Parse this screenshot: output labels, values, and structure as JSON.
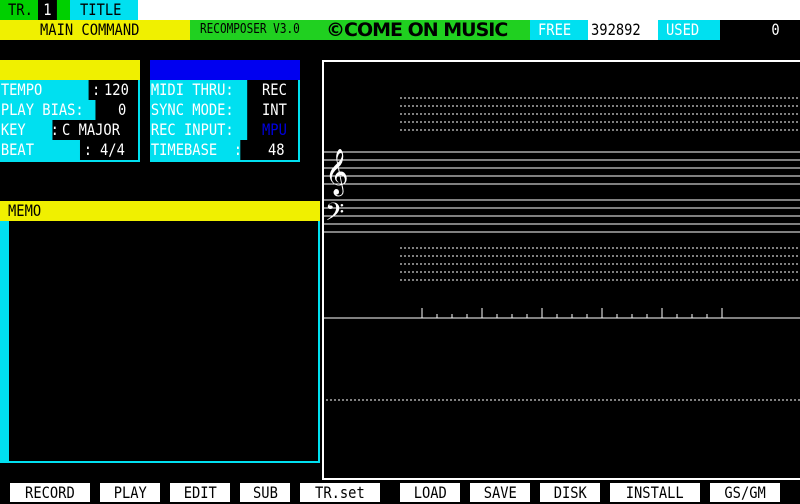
{
  "header": {
    "track_label": "TR.",
    "track_number": "1",
    "title_label": "TITLE",
    "title_value": ""
  },
  "status": {
    "mode": "MAIN COMMAND",
    "product": "RECOMPOSER V3.0",
    "copyright": "©COME ON MUSIC",
    "free_label": "FREE",
    "free_value": "392892",
    "used_label": "USED",
    "used_value": "0"
  },
  "params_left": [
    {
      "key": "TEMPO      :",
      "value": "120"
    },
    {
      "key": "PLAY BIAS: ",
      "value": "0"
    },
    {
      "key": "KEY   :",
      "value": "C MAJOR"
    },
    {
      "key": "BEAT      :",
      "value": "4/4"
    }
  ],
  "params_right": [
    {
      "key": "MIDI THRU:",
      "value": "REC",
      "value_color": "#ffffff"
    },
    {
      "key": "SYNC MODE:",
      "value": "INT",
      "value_color": "#ffffff"
    },
    {
      "key": "REC INPUT:",
      "value": "MPU",
      "value_color": "#0000e0"
    },
    {
      "key": "TIMEBASE  :",
      "value": "48",
      "value_color": "#ffffff"
    }
  ],
  "memo": {
    "label": "MEMO",
    "text": ""
  },
  "score": {
    "treble_clef": "𝄞",
    "bass_clef": "𝄢"
  },
  "function_keys": [
    "RECORD",
    "PLAY",
    "EDIT",
    "SUB",
    "TR.set",
    "LOAD",
    "SAVE",
    "DISK",
    "INSTALL",
    "GS/GM"
  ],
  "colors": {
    "green": "#00d000",
    "cyan": "#00e0f0",
    "yellow": "#f0f000",
    "blue": "#0000f0",
    "brand_green": "#20d020"
  }
}
